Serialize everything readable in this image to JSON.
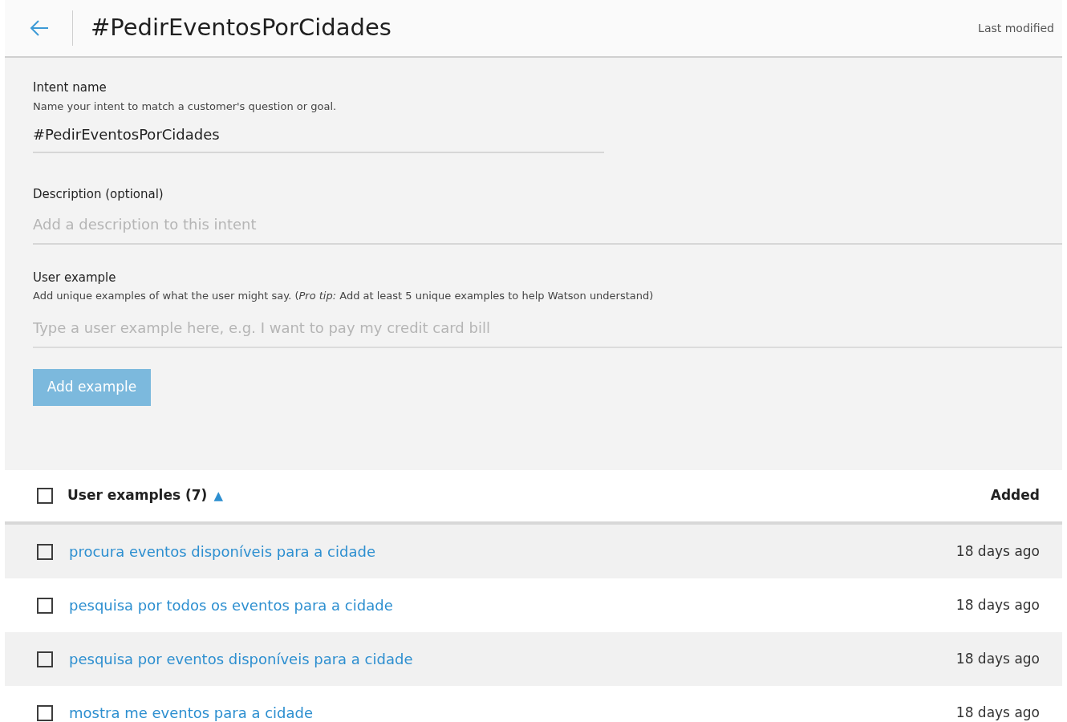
{
  "header": {
    "title": "#PedirEventosPorCidades",
    "last_modified": "Last modified"
  },
  "intent_name": {
    "label": "Intent name",
    "help": "Name your intent to match a customer's question or goal.",
    "value": "#PedirEventosPorCidades"
  },
  "description": {
    "label": "Description (optional)",
    "placeholder": "Add a description to this intent"
  },
  "user_example": {
    "label": "User example",
    "help": "Add unique examples of what the user might say. (*Pro tip:* Add at least 5 unique examples to help Watson understand)",
    "placeholder": "Type a user example here, e.g. I want to pay my credit card bill",
    "button": "Add example"
  },
  "table": {
    "select_all_checked": false,
    "column_1": "User examples (7)",
    "sort_indicator": "▲",
    "column_2": "Added",
    "rows": [
      {
        "text": "procura eventos disponíveis para a cidade",
        "added": "18 days ago",
        "checked": false
      },
      {
        "text": "pesquisa por todos os eventos para a cidade",
        "added": "18 days ago",
        "checked": false
      },
      {
        "text": "pesquisa por eventos disponíveis para a cidade",
        "added": "18 days ago",
        "checked": false
      },
      {
        "text": "mostra me eventos para a cidade",
        "added": "18 days ago",
        "checked": false
      }
    ]
  }
}
